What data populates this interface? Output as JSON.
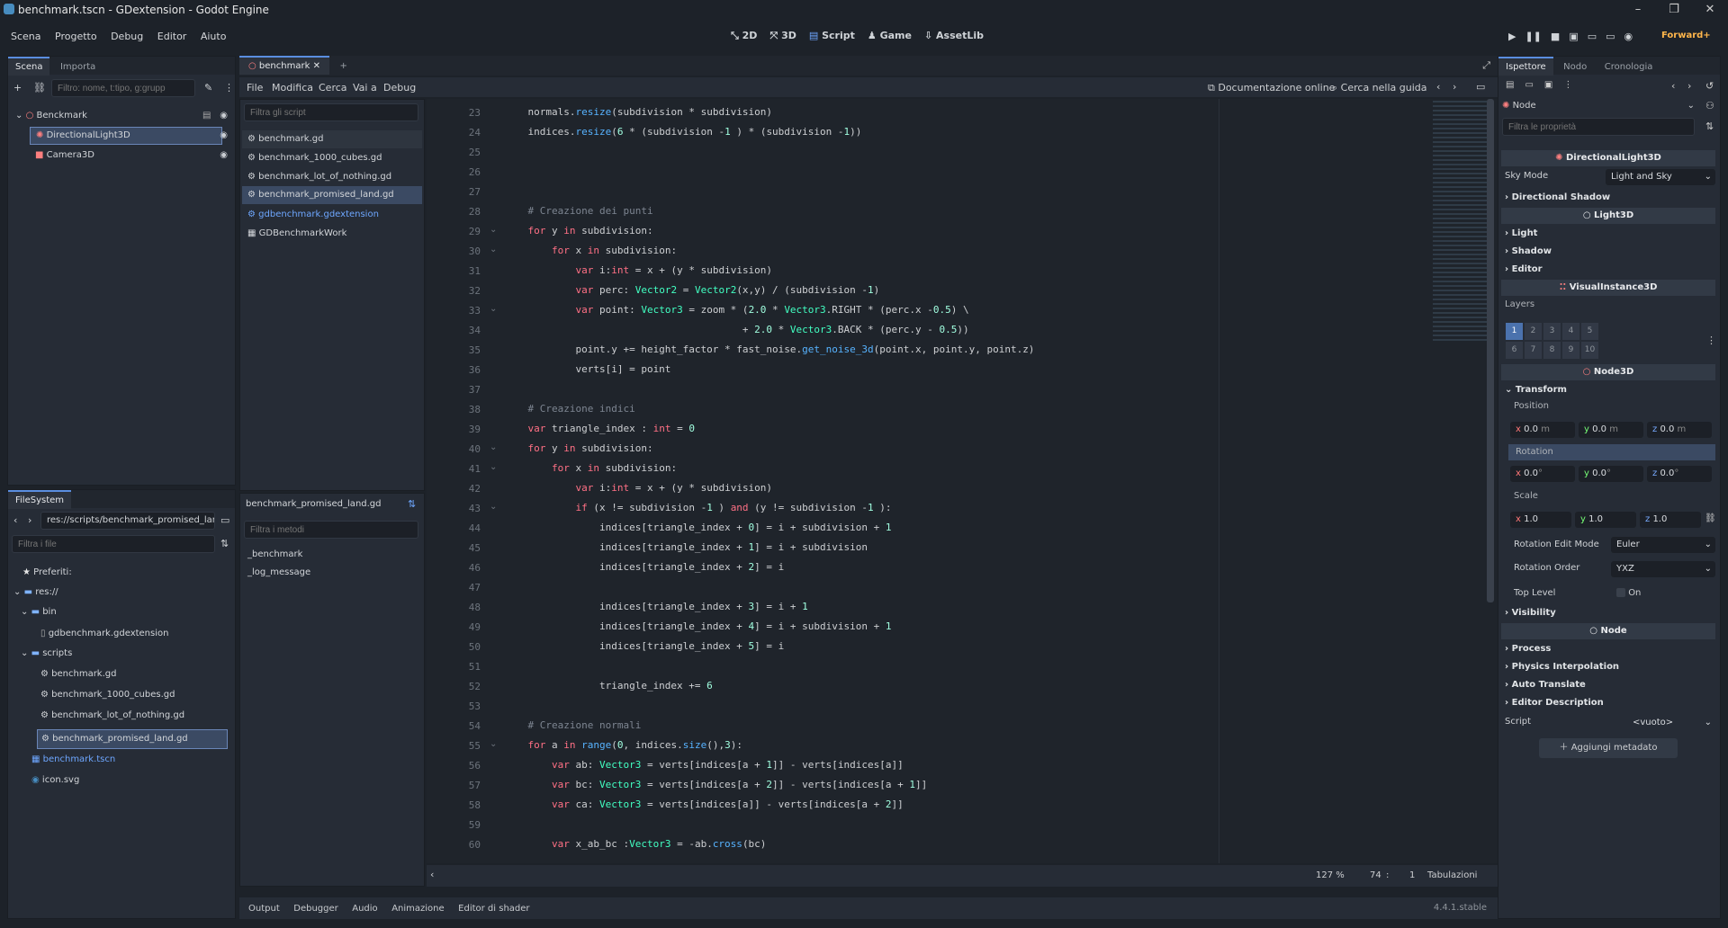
{
  "window": {
    "title": "benchmark.tscn - GDextension - Godot Engine",
    "controls": [
      "–",
      "❐",
      "✕"
    ]
  },
  "menu": [
    "Scena",
    "Progetto",
    "Debug",
    "Editor",
    "Aiuto"
  ],
  "workspaces": [
    "2D",
    "3D",
    "Script",
    "Game",
    "AssetLib"
  ],
  "active_workspace": "Script",
  "renderer": "Forward+",
  "scene_dock": {
    "tabs": [
      "Scena",
      "Importa"
    ],
    "filter_placeholder": "Filtro: nome, t:tipo, g:grupp",
    "nodes": [
      {
        "label": "Benckmark"
      },
      {
        "label": "DirectionalLight3D"
      },
      {
        "label": "Camera3D"
      }
    ]
  },
  "filesystem": {
    "tab": "FileSystem",
    "path": "res://scripts/benchmark_promised_lan",
    "filter_placeholder": "Filtra i file",
    "items": [
      {
        "label": "Preferiti:"
      },
      {
        "label": "res://"
      },
      {
        "label": "bin"
      },
      {
        "label": "gdbenchmark.gdextension"
      },
      {
        "label": "scripts"
      },
      {
        "label": "benchmark.gd"
      },
      {
        "label": "benchmark_1000_cubes.gd"
      },
      {
        "label": "benchmark_lot_of_nothing.gd"
      },
      {
        "label": "benchmark_promised_land.gd"
      },
      {
        "label": "benchmark.tscn"
      },
      {
        "label": "icon.svg"
      }
    ]
  },
  "script_editor": {
    "tab": "benchmark",
    "menus": [
      "File",
      "Modifica",
      "Cerca",
      "Vai a",
      "Debug"
    ],
    "online_docs": "Documentazione online",
    "search_help": "Cerca nella guida",
    "script_filter_placeholder": "Filtra gli script",
    "scripts": [
      "benchmark.gd",
      "benchmark_1000_cubes.gd",
      "benchmark_lot_of_nothing.gd",
      "benchmark_promised_land.gd",
      "gdbenchmark.gdextension",
      "GDBenchmarkWork"
    ],
    "current_script": "benchmark_promised_land.gd",
    "methods_filter_placeholder": "Filtra i metodi",
    "methods": [
      "_benchmark",
      "_log_message"
    ],
    "status": {
      "zoom": "127 %",
      "line": "74",
      "col": "1",
      "indent": "Tabulazioni"
    }
  },
  "code_lines": [
    {
      "n": "23",
      "t": "    normals.resize(subdivision * subdivision)"
    },
    {
      "n": "24",
      "t": "    indices.resize(6 * (subdivision -1 ) * (subdivision -1))"
    },
    {
      "n": "25",
      "t": ""
    },
    {
      "n": "26",
      "t": ""
    },
    {
      "n": "27",
      "t": ""
    },
    {
      "n": "28",
      "t": "    # Creazione dei punti"
    },
    {
      "n": "29",
      "t": "    for y in subdivision:"
    },
    {
      "n": "30",
      "t": "        for x in subdivision:"
    },
    {
      "n": "31",
      "t": "            var i:int = x + (y * subdivision)"
    },
    {
      "n": "32",
      "t": "            var perc: Vector2 = Vector2(x,y) / (subdivision -1)"
    },
    {
      "n": "33",
      "t": "            var point: Vector3 = zoom * (2.0 * Vector3.RIGHT * (perc.x -0.5) \\"
    },
    {
      "n": "34",
      "t": "                                        + 2.0 * Vector3.BACK * (perc.y - 0.5))"
    },
    {
      "n": "35",
      "t": "            point.y += height_factor * fast_noise.get_noise_3d(point.x, point.y, point.z)"
    },
    {
      "n": "36",
      "t": "            verts[i] = point"
    },
    {
      "n": "37",
      "t": ""
    },
    {
      "n": "38",
      "t": "    # Creazione indici"
    },
    {
      "n": "39",
      "t": "    var triangle_index : int = 0"
    },
    {
      "n": "40",
      "t": "    for y in subdivision:"
    },
    {
      "n": "41",
      "t": "        for x in subdivision:"
    },
    {
      "n": "42",
      "t": "            var i:int = x + (y * subdivision)"
    },
    {
      "n": "43",
      "t": "            if (x != subdivision -1 ) and (y != subdivision -1 ):"
    },
    {
      "n": "44",
      "t": "                indices[triangle_index + 0] = i + subdivision + 1"
    },
    {
      "n": "45",
      "t": "                indices[triangle_index + 1] = i + subdivision"
    },
    {
      "n": "46",
      "t": "                indices[triangle_index + 2] = i"
    },
    {
      "n": "47",
      "t": ""
    },
    {
      "n": "48",
      "t": "                indices[triangle_index + 3] = i + 1"
    },
    {
      "n": "49",
      "t": "                indices[triangle_index + 4] = i + subdivision + 1"
    },
    {
      "n": "50",
      "t": "                indices[triangle_index + 5] = i"
    },
    {
      "n": "51",
      "t": ""
    },
    {
      "n": "52",
      "t": "                triangle_index += 6"
    },
    {
      "n": "53",
      "t": ""
    },
    {
      "n": "54",
      "t": "    # Creazione normali"
    },
    {
      "n": "55",
      "t": "    for a in range(0, indices.size(),3):"
    },
    {
      "n": "56",
      "t": "        var ab: Vector3 = verts[indices[a + 1]] - verts[indices[a]]"
    },
    {
      "n": "57",
      "t": "        var bc: Vector3 = verts[indices[a + 2]] - verts[indices[a + 1]]"
    },
    {
      "n": "58",
      "t": "        var ca: Vector3 = verts[indices[a]] - verts[indices[a + 2]]"
    },
    {
      "n": "59",
      "t": ""
    },
    {
      "n": "60",
      "t": "        var x_ab_bc :Vector3 = -ab.cross(bc)"
    }
  ],
  "inspector": {
    "tabs": [
      "Ispettore",
      "Nodo",
      "Cronologia"
    ],
    "node": "Node",
    "filter_placeholder": "Filtra le proprietà",
    "class_header": "DirectionalLight3D",
    "sky_mode_label": "Sky Mode",
    "sky_mode_value": "Light and Sky",
    "directional_shadow": "Directional Shadow",
    "light3d": "Light3D",
    "light": "Light",
    "shadow": "Shadow",
    "editor": "Editor",
    "visual_instance": "VisualInstance3D",
    "layers_label": "Layers",
    "layers": [
      "1",
      "2",
      "3",
      "4",
      "5",
      "6",
      "7",
      "8",
      "9",
      "10"
    ],
    "node3d": "Node3D",
    "transform": "Transform",
    "position_label": "Position",
    "position": {
      "x": "0.0",
      "y": "0.0",
      "z": "0.0",
      "unit": "m"
    },
    "rotation_label": "Rotation",
    "rotation": {
      "x": "0.0",
      "y": "0.0",
      "z": "0.0",
      "unit": "°"
    },
    "scale_label": "Scale",
    "scale": {
      "x": "1.0",
      "y": "1.0",
      "z": "1.0"
    },
    "rotation_edit_mode_label": "Rotation Edit Mode",
    "rotation_edit_mode": "Euler",
    "rotation_order_label": "Rotation Order",
    "rotation_order": "YXZ",
    "top_level_label": "Top Level",
    "top_level_value": "On",
    "visibility": "Visibility",
    "process": "Process",
    "physics_interpolation": "Physics Interpolation",
    "auto_translate": "Auto Translate",
    "editor_description": "Editor Description",
    "script_label": "Script",
    "script_value": "<vuoto>",
    "add_metadata": "Aggiungi metadato"
  },
  "bottom_panel": {
    "tabs": [
      "Output",
      "Debugger",
      "Audio",
      "Animazione",
      "Editor di shader"
    ],
    "version": "4.4.1.stable"
  }
}
